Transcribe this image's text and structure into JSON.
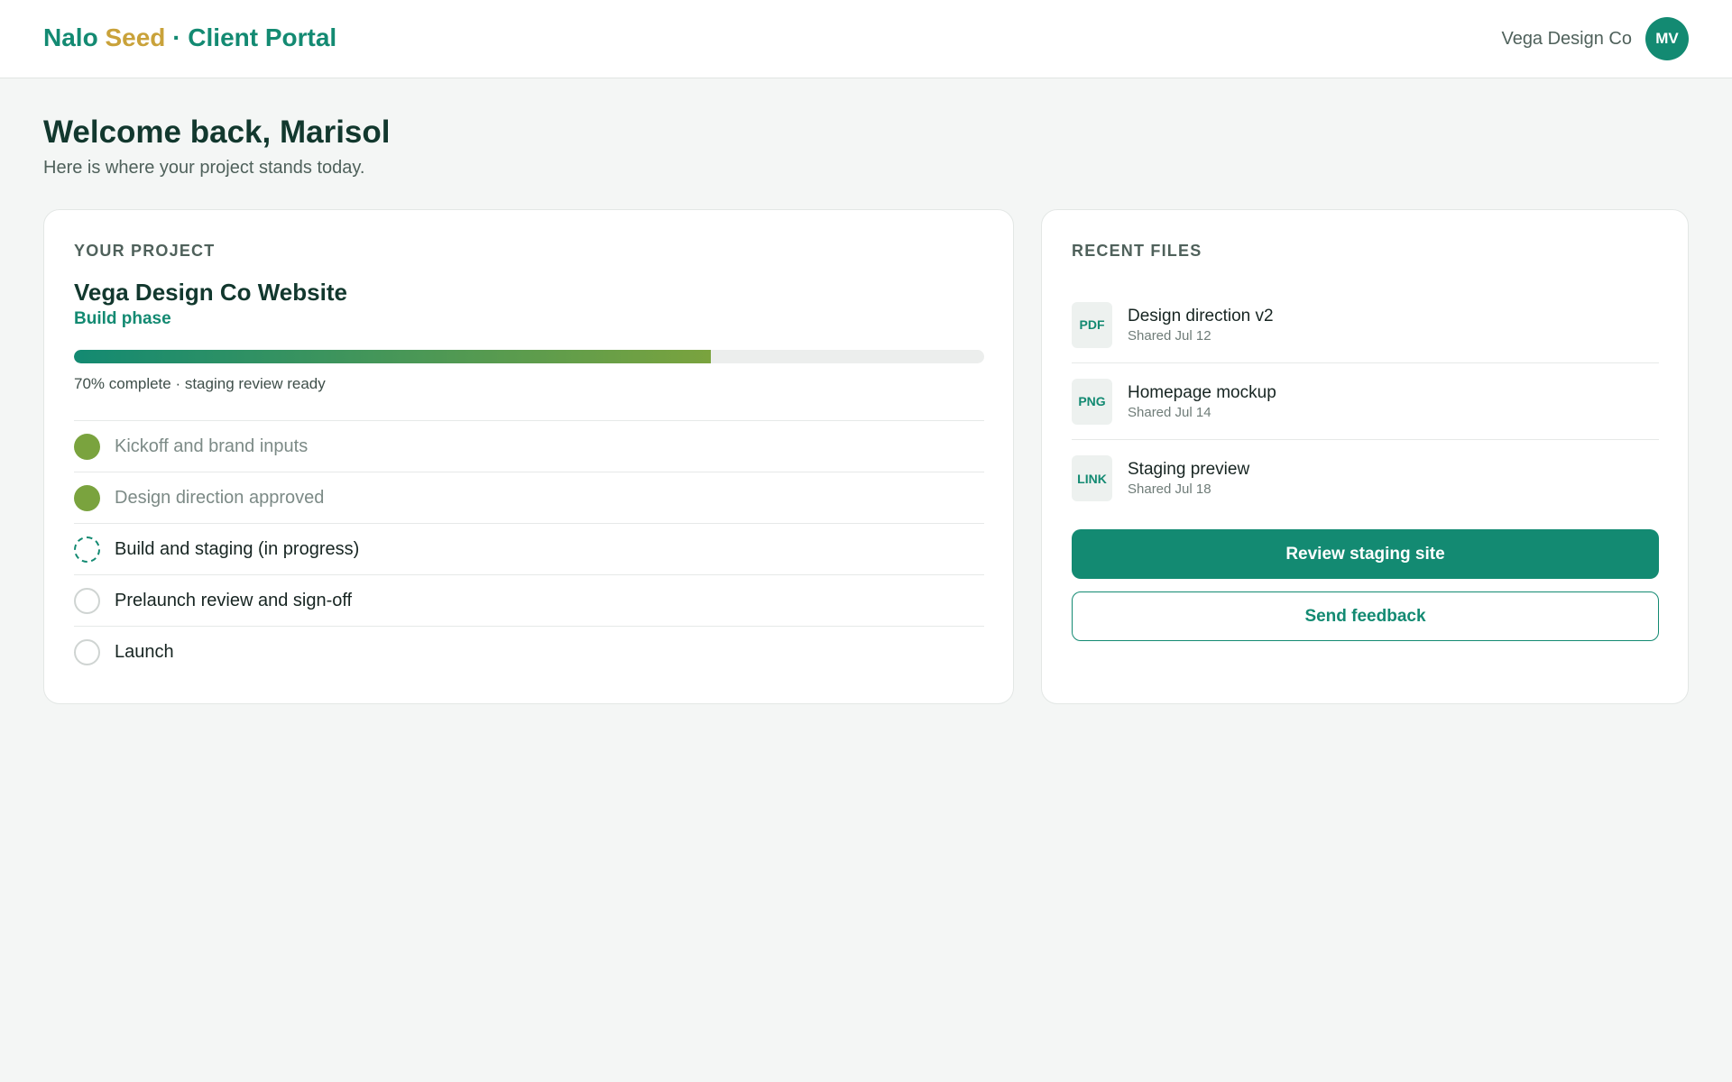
{
  "header": {
    "brand_part1": "Nalo",
    "brand_part2": "Seed",
    "brand_separator": "·",
    "brand_part3": "Client Portal",
    "account_name": "Vega Design Co",
    "avatar_initials": "MV"
  },
  "welcome": {
    "title": "Welcome back, Marisol",
    "subtitle": "Here is where your project stands today."
  },
  "project": {
    "section_label": "YOUR PROJECT",
    "name": "Vega Design Co Website",
    "phase": "Build phase",
    "progress_percent": 70,
    "progress_text": "70% complete · staging review ready",
    "milestones": [
      {
        "label": "Kickoff and brand inputs",
        "status": "done"
      },
      {
        "label": "Design direction approved",
        "status": "done"
      },
      {
        "label": "Build and staging (in progress)",
        "status": "progress"
      },
      {
        "label": "Prelaunch review and sign-off",
        "status": "todo"
      },
      {
        "label": "Launch",
        "status": "todo"
      }
    ]
  },
  "files": {
    "section_label": "RECENT FILES",
    "items": [
      {
        "type": "PDF",
        "name": "Design direction v2",
        "date": "Shared Jul 12"
      },
      {
        "type": "PNG",
        "name": "Homepage mockup",
        "date": "Shared Jul 14"
      },
      {
        "type": "LINK",
        "name": "Staging preview",
        "date": "Shared Jul 18"
      }
    ],
    "primary_button": "Review staging site",
    "secondary_button": "Send feedback"
  },
  "colors": {
    "brand_green": "#138a72",
    "brand_gold": "#c9a23a",
    "done_green": "#7aa33e",
    "background": "#f4f6f5"
  }
}
